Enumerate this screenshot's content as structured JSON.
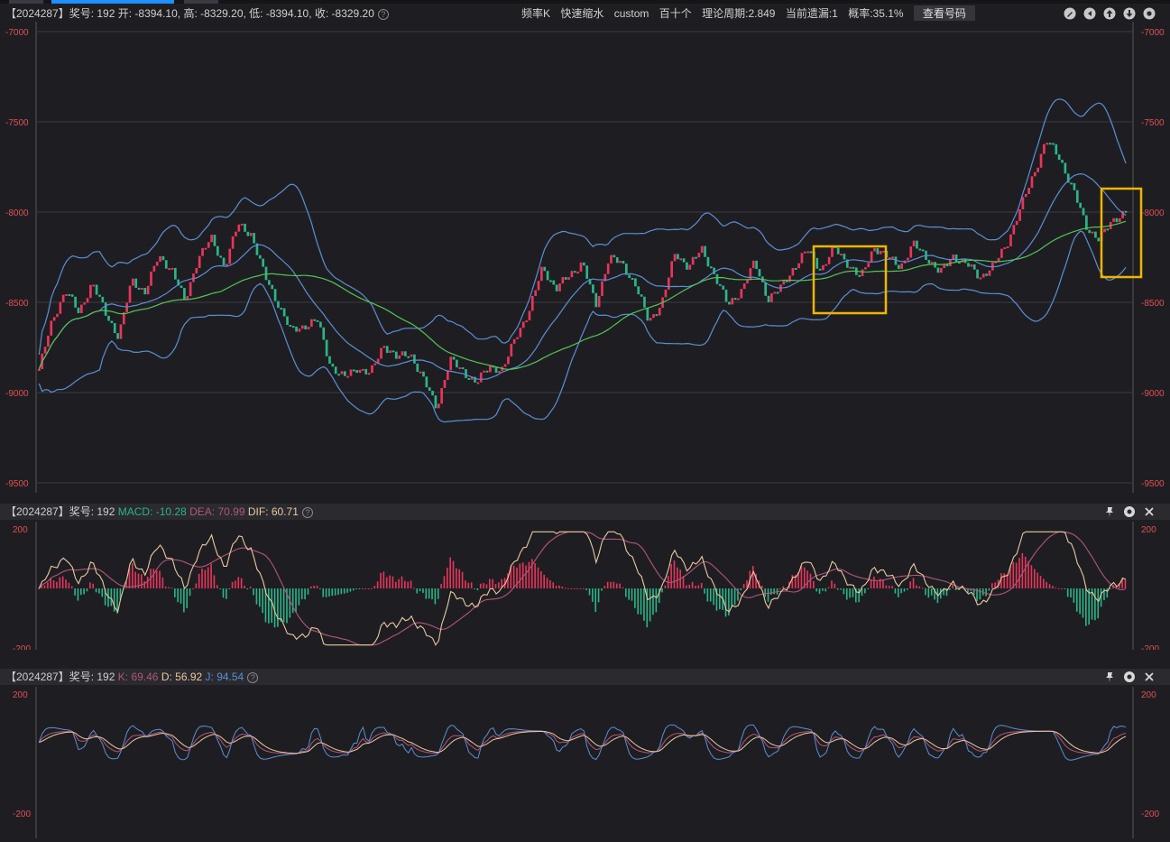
{
  "main": {
    "info": "【2024287】奖号: 192  开: -8394.10, 高: -8329.20, 低: -8394.10, 收: -8329.20",
    "tags": [
      "频率K",
      "快速缩水",
      "custom",
      "百十个",
      "理论周期:2.849",
      "当前遗漏:1",
      "概率:35.1%"
    ],
    "check_button": "查看号码",
    "y_ticks": [
      "-7000",
      "-7500",
      "-8000",
      "-8500",
      "-9000",
      "-9500"
    ],
    "icons": [
      "edit-icon",
      "back-icon",
      "arrow-up-icon",
      "arrow-down-icon",
      "settings-icon"
    ]
  },
  "macd": {
    "prefix": "【2024287】奖号: 192",
    "macd_label": "MACD: -10.28",
    "dea_label": "DEA: 70.99",
    "dif_label": "DIF: 60.71",
    "y_ticks": [
      "200",
      "-200"
    ]
  },
  "kdj": {
    "prefix": "【2024287】奖号: 192",
    "k_label": "K: 69.46",
    "d_label": "D: 56.92",
    "j_label": "J: 94.54",
    "y_ticks": [
      "200",
      "-200"
    ]
  },
  "colors": {
    "up": "#e8355a",
    "down": "#2bb588",
    "band": "#5b8fd6",
    "ma": "#54c454",
    "macd_dif": "#e8c9a0",
    "macd_dea": "#b2567a",
    "k": "#b2567a",
    "d": "#e8c9a0",
    "j": "#5b8fd6",
    "highlight": "#f0b400"
  },
  "chart_data": [
    {
      "type": "candlestick",
      "ylim": [
        -9500,
        -7000
      ],
      "last": {
        "open": -8394.1,
        "high": -8329.2,
        "low": -8394.1,
        "close": -8329.2
      },
      "close_path": [
        -8870,
        -8600,
        -8430,
        -8560,
        -8390,
        -8560,
        -8690,
        -8380,
        -8440,
        -8250,
        -8310,
        -8500,
        -8250,
        -8150,
        -8300,
        -8070,
        -8120,
        -8350,
        -8500,
        -8660,
        -8630,
        -8600,
        -8850,
        -8920,
        -8860,
        -8900,
        -8730,
        -8810,
        -8780,
        -8930,
        -9080,
        -8820,
        -8880,
        -8950,
        -8850,
        -8880,
        -8680,
        -8550,
        -8300,
        -8430,
        -8350,
        -8280,
        -8520,
        -8250,
        -8290,
        -8400,
        -8610,
        -8500,
        -8230,
        -8300,
        -8210,
        -8350,
        -8520,
        -8430,
        -8280,
        -8480,
        -8420,
        -8300,
        -8210,
        -8320,
        -8200,
        -8280,
        -8370,
        -8190,
        -8250,
        -8300,
        -8180,
        -8250,
        -8340,
        -8240,
        -8290,
        -8360,
        -8300,
        -8180,
        -7990,
        -7800,
        -7600,
        -7700,
        -7870,
        -8080,
        -8150,
        -8050,
        -7990
      ]
    },
    {
      "type": "bar+line",
      "name": "MACD",
      "ylim": [
        -200,
        200
      ],
      "macd": -10.28,
      "dea": 70.99,
      "dif": 60.71
    },
    {
      "type": "line",
      "name": "KDJ",
      "ylim": [
        -200,
        200
      ],
      "k": 69.46,
      "d": 56.92,
      "j": 94.54
    }
  ]
}
